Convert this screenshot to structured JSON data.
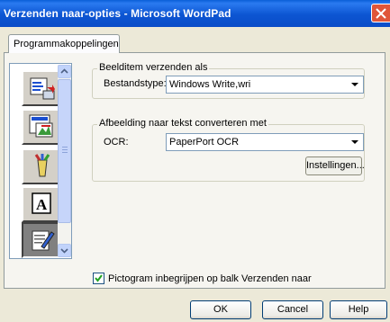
{
  "window": {
    "title": "Verzenden naar-opties - Microsoft WordPad"
  },
  "tabs": [
    {
      "label": "Programmakoppelingen",
      "selected": true
    }
  ],
  "icon_list": {
    "items": [
      {
        "icon": "document-send-icon"
      },
      {
        "icon": "picture-document-icon"
      },
      {
        "icon": "paintbrush-icon"
      },
      {
        "icon": "text-a-icon"
      },
      {
        "icon": "notepad-icon",
        "selected": true
      }
    ]
  },
  "send_group": {
    "legend": "Beelditem verzenden als",
    "file_type_label": "Bestandstype:",
    "file_type_value": "Windows Write,wri"
  },
  "ocr_group": {
    "legend": "Afbeelding naar tekst converteren met",
    "ocr_label": "OCR:",
    "ocr_value": "PaperPort OCR",
    "settings_button": "Instellingen..."
  },
  "checkbox": {
    "label": "Pictogram inbegrijpen op balk Verzenden naar",
    "checked": true
  },
  "buttons": {
    "ok": "OK",
    "cancel": "Cancel",
    "help": "Help"
  },
  "colors": {
    "titlebar": "#0a5fd8",
    "dialog_bg": "#ece9d8",
    "selected_icon_bg": "#808080"
  }
}
